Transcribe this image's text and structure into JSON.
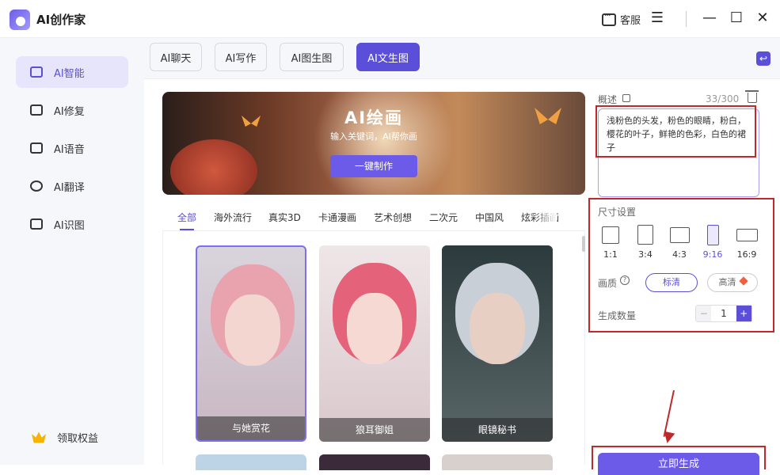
{
  "app": {
    "title": "AI创作家"
  },
  "window": {
    "service_label": "客服",
    "menu": "☰",
    "minimize": "—",
    "maximize": "☐",
    "close": "✕"
  },
  "sidebar": {
    "items": [
      {
        "label": "AI智能",
        "icon": "smart-icon",
        "active": true
      },
      {
        "label": "AI修复",
        "icon": "repair-icon"
      },
      {
        "label": "AI语音",
        "icon": "voice-icon"
      },
      {
        "label": "AI翻译",
        "icon": "translate-icon"
      },
      {
        "label": "AI识图",
        "icon": "image-recognition-icon"
      }
    ],
    "reward": "领取权益"
  },
  "tabs": [
    {
      "label": "AI聊天"
    },
    {
      "label": "AI写作"
    },
    {
      "label": "AI图生图"
    },
    {
      "label": "AI文生图",
      "active": true
    }
  ],
  "banner": {
    "title": "AI绘画",
    "subtitle": "输入关键词，AI帮你画",
    "button": "一键制作"
  },
  "categories": [
    "全部",
    "海外流行",
    "真实3D",
    "卡通漫画",
    "艺术创想",
    "二次元",
    "中国风",
    "炫彩插画"
  ],
  "gallery": [
    {
      "caption": "与她赏花"
    },
    {
      "caption": "狼耳御姐"
    },
    {
      "caption": "眼镜秘书"
    }
  ],
  "panel": {
    "desc_label": "概述",
    "counter": "33/300",
    "desc_text": "浅粉色的头发，粉色的眼睛，粉白，樱花的叶子，鲜艳的色彩，白色的裙子",
    "size_label": "尺寸设置",
    "ratios": [
      "1:1",
      "3:4",
      "4:3",
      "9:16",
      "16:9"
    ],
    "selected_ratio": "9:16",
    "quality_label": "画质",
    "quality_help": "?",
    "quality_options": [
      "标清",
      "高清"
    ],
    "count_label": "生成数量",
    "count_minus": "−",
    "count_value": "1",
    "count_plus": "+",
    "generate_button": "立即生成"
  },
  "colors": {
    "accent": "#5b4fd9",
    "annotation": "#c0292b"
  }
}
